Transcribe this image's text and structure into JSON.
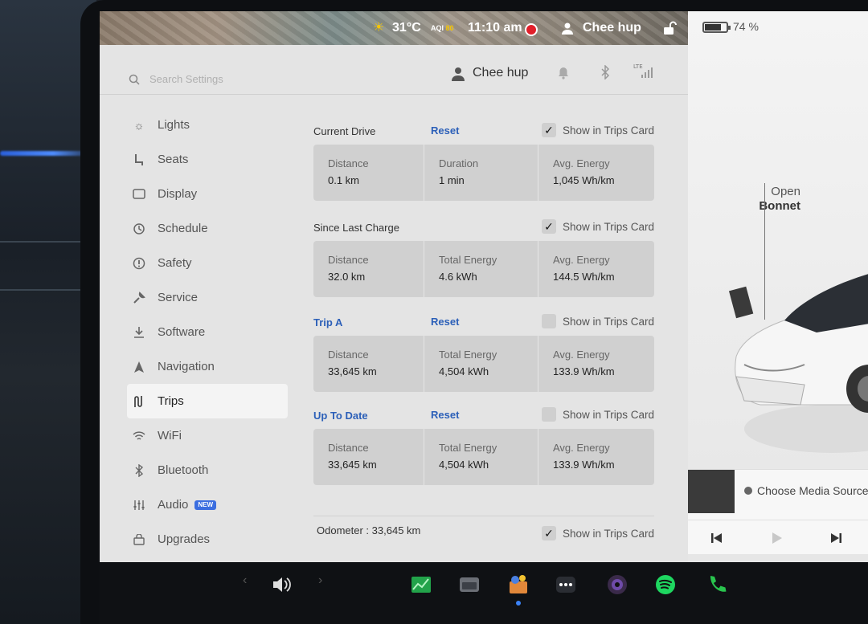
{
  "status_bar": {
    "temperature": "31°C",
    "aqi_label": "AQI",
    "aqi_value": "80",
    "time": "11:10 am",
    "user": "Chee hup"
  },
  "right_panel": {
    "battery": "74 %",
    "open_label": "Open",
    "bonnet_label": "Bonnet",
    "media_source": "Choose Media Source"
  },
  "header": {
    "search_placeholder": "Search Settings",
    "user_name": "Chee hup",
    "lte_label": "LTE"
  },
  "sidebar": {
    "items": [
      {
        "label": "Lights",
        "icon": "sun-icon"
      },
      {
        "label": "Seats",
        "icon": "seat-icon"
      },
      {
        "label": "Display",
        "icon": "display-icon"
      },
      {
        "label": "Schedule",
        "icon": "clock-icon"
      },
      {
        "label": "Safety",
        "icon": "alert-icon"
      },
      {
        "label": "Service",
        "icon": "wrench-icon"
      },
      {
        "label": "Software",
        "icon": "download-icon"
      },
      {
        "label": "Navigation",
        "icon": "navigation-icon"
      },
      {
        "label": "Trips",
        "icon": "trips-icon",
        "active": true
      },
      {
        "label": "WiFi",
        "icon": "wifi-icon"
      },
      {
        "label": "Bluetooth",
        "icon": "bluetooth-icon"
      },
      {
        "label": "Audio",
        "icon": "equalizer-icon",
        "badge": "NEW"
      },
      {
        "label": "Upgrades",
        "icon": "bag-icon"
      }
    ]
  },
  "trips": {
    "show_label": "Show in Trips Card",
    "reset_label": "Reset",
    "current_drive": {
      "title": "Current Drive",
      "checked": true,
      "stats": [
        {
          "label": "Distance",
          "value": "0.1 km"
        },
        {
          "label": "Duration",
          "value": "1 min"
        },
        {
          "label": "Avg. Energy",
          "value": "1,045  Wh/km"
        }
      ]
    },
    "since_last_charge": {
      "title": "Since Last Charge",
      "checked": true,
      "stats": [
        {
          "label": "Distance",
          "value": "32.0  km"
        },
        {
          "label": "Total Energy",
          "value": "4.6  kWh"
        },
        {
          "label": "Avg. Energy",
          "value": "144.5  Wh/km"
        }
      ]
    },
    "trip_a": {
      "title": "Trip A",
      "checked": false,
      "stats": [
        {
          "label": "Distance",
          "value": "33,645  km"
        },
        {
          "label": "Total Energy",
          "value": "4,504  kWh"
        },
        {
          "label": "Avg. Energy",
          "value": "133.9  Wh/km"
        }
      ]
    },
    "up_to_date": {
      "title": "Up To Date",
      "checked": false,
      "stats": [
        {
          "label": "Distance",
          "value": "33,645  km"
        },
        {
          "label": "Total Energy",
          "value": "4,504  kWh"
        },
        {
          "label": "Avg. Energy",
          "value": "133.9  Wh/km"
        }
      ]
    },
    "odometer_label": "Odometer  :",
    "odometer_value": "33,645  km",
    "odometer_checked": true
  },
  "colors": {
    "accent_blue": "#2b5fb8",
    "record_red": "#e1202b",
    "sun_yellow": "#f5c400"
  }
}
